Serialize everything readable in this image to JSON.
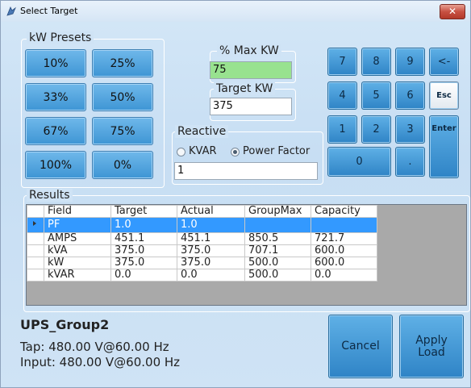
{
  "window": {
    "title": "Select Target",
    "close_glyph": "✕"
  },
  "presets": {
    "label": "kW Presets",
    "buttons": [
      "10%",
      "25%",
      "33%",
      "50%",
      "67%",
      "75%",
      "100%",
      "0%"
    ]
  },
  "max_kw": {
    "label": "% Max KW",
    "value": "75"
  },
  "target_kw": {
    "label": "Target KW",
    "value": "375"
  },
  "reactive": {
    "label": "Reactive",
    "option_kvar": "KVAR",
    "option_pf": "Power Factor",
    "selected": "Power Factor",
    "value": "1"
  },
  "keypad": {
    "k7": "7",
    "k8": "8",
    "k9": "9",
    "back": "<-",
    "k4": "4",
    "k5": "5",
    "k6": "6",
    "esc": "Esc",
    "k1": "1",
    "k2": "2",
    "k3": "3",
    "enter": "Enter",
    "k0": "0",
    "dot": "."
  },
  "results": {
    "label": "Results",
    "columns": [
      "Field",
      "Target",
      "Actual",
      "GroupMax",
      "Capacity"
    ],
    "rows": [
      [
        "PF",
        "1.0",
        "1.0",
        "",
        ""
      ],
      [
        "AMPS",
        "451.1",
        "451.1",
        "850.5",
        "721.7"
      ],
      [
        "kVA",
        "375.0",
        "375.0",
        "707.1",
        "600.0"
      ],
      [
        "kW",
        "375.0",
        "375.0",
        "500.0",
        "600.0"
      ],
      [
        "kVAR",
        "0.0",
        "0.0",
        "500.0",
        "0.0"
      ]
    ],
    "selected_row": 0
  },
  "group": {
    "name": "UPS_Group2",
    "tap": "Tap: 480.00 V@60.00 Hz",
    "input": "Input: 480.00 V@60.00 Hz"
  },
  "actions": {
    "cancel": "Cancel",
    "apply_line1": "Apply",
    "apply_line2": "Load"
  },
  "colors": {
    "selection": "#3399ff",
    "valid_field": "#98e28f",
    "button": "#3e95d4"
  }
}
